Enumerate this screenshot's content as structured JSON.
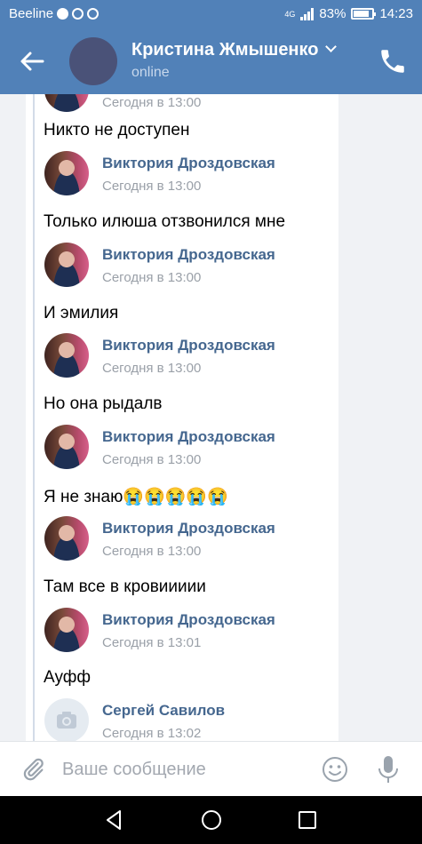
{
  "statusbar": {
    "carrier": "Beeline",
    "network": "4G",
    "battery": "83%",
    "battery_level": 0.83,
    "time": "14:23"
  },
  "header": {
    "title": "Кристина Жмышенко",
    "status": "online",
    "icons": [
      "back-arrow-icon",
      "chevron-down-icon",
      "phone-icon"
    ],
    "accent": "#5181b8"
  },
  "messages": [
    {
      "author": "",
      "time": "Сегодня в 13:00",
      "text": "Никто не доступен"
    },
    {
      "author": "Виктория Дроздовская",
      "time": "Сегодня в 13:00",
      "text": "Только илюша отзвонился мне"
    },
    {
      "author": "Виктория Дроздовская",
      "time": "Сегодня в 13:00",
      "text": "И эмилия"
    },
    {
      "author": "Виктория Дроздовская",
      "time": "Сегодня в 13:00",
      "text": "Но она рыдалв"
    },
    {
      "author": "Виктория Дроздовская",
      "time": "Сегодня в 13:00",
      "text": "Я не знаю😭😭😭😭😭"
    },
    {
      "author": "Виктория Дроздовская",
      "time": "Сегодня в 13:00",
      "text": "Там все в кровиииии"
    },
    {
      "author": "Виктория Дроздовская",
      "time": "Сегодня в 13:01",
      "text": "Ауфф"
    },
    {
      "author": "Сергей Савилов",
      "time": "Сегодня в 13:02",
      "text": ""
    }
  ],
  "composer": {
    "placeholder": "Ваше сообщение",
    "icons": [
      "paperclip-icon",
      "emoji-icon",
      "microphone-icon"
    ]
  },
  "navbar": {
    "icons": [
      "nav-back-icon",
      "nav-home-icon",
      "nav-recent-icon"
    ]
  }
}
